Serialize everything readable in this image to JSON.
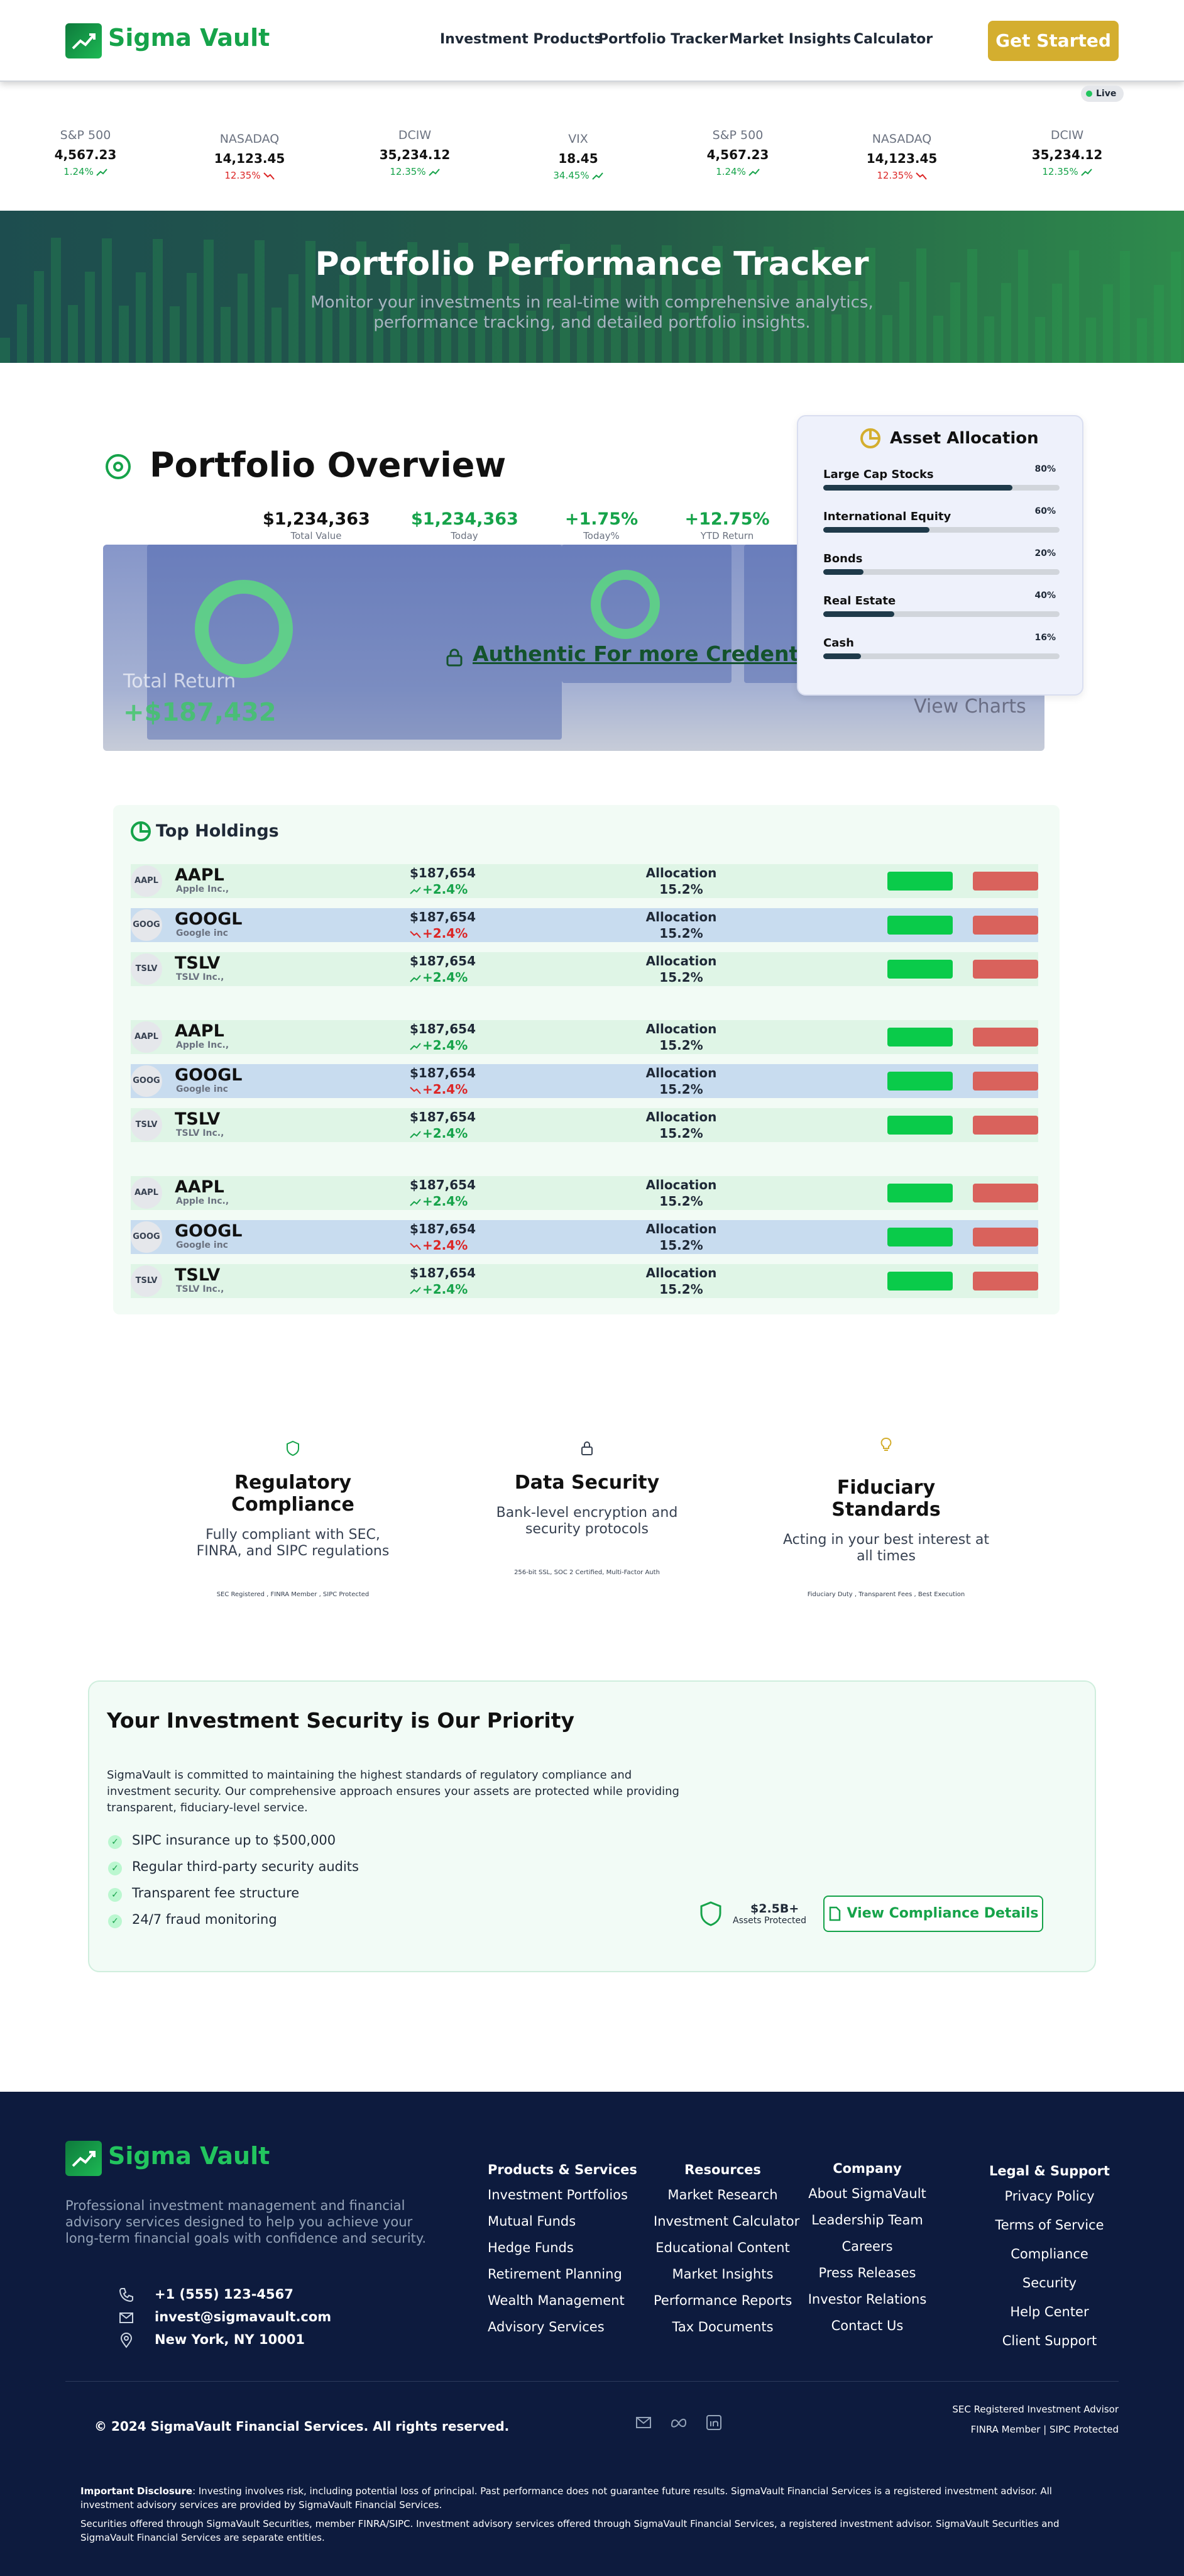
{
  "brand": "Sigma Vault",
  "nav": {
    "links": [
      "Investment Products",
      "Portfolio Tracker",
      "Market Insights",
      "Calculator"
    ],
    "cta": "Get Started"
  },
  "ticker": {
    "live": "Live",
    "items": [
      {
        "sym": "S&P 500",
        "val": "4,567.23",
        "chg": "1.24%",
        "dir": "up"
      },
      {
        "sym": "NASADAQ",
        "val": "14,123.45",
        "chg": "12.35%",
        "dir": "down"
      },
      {
        "sym": "DCIW",
        "val": "35,234.12",
        "chg": "12.35%",
        "dir": "up"
      },
      {
        "sym": "VIX",
        "val": "18.45",
        "chg": "34.45%",
        "dir": "up"
      },
      {
        "sym": "S&P 500",
        "val": "4,567.23",
        "chg": "1.24%",
        "dir": "up"
      },
      {
        "sym": "NASADAQ",
        "val": "14,123.45",
        "chg": "12.35%",
        "dir": "down"
      },
      {
        "sym": "DCIW",
        "val": "35,234.12",
        "chg": "12.35%",
        "dir": "up"
      }
    ]
  },
  "hero": {
    "title": "Portfolio Performance Tracker",
    "subtitle": "Monitor your investments in real-time with comprehensive analytics, performance tracking, and detailed portfolio insights."
  },
  "overview": {
    "title": "Portfolio Overview",
    "stats": [
      {
        "value": "$1,234,363",
        "label": "Total Value",
        "color": "#111111"
      },
      {
        "value": "$1,234,363",
        "label": "Today",
        "color": "#16a34a"
      },
      {
        "value": "+1.75%",
        "label": "Today%",
        "color": "#16a34a"
      },
      {
        "value": "+12.75%",
        "label": "YTD Return",
        "color": "#16a34a"
      }
    ],
    "locked_total_label": "Total Return",
    "locked_total_value": "+$187,432",
    "locked_view": "View Charts",
    "auth_link": "Authentic For more Credentials"
  },
  "allocation": {
    "title": "Asset Allocation",
    "items": [
      {
        "name": "Large Cap Stocks",
        "pct": "80%",
        "fill": 0.8
      },
      {
        "name": "International Equity",
        "pct": "60%",
        "fill": 0.45
      },
      {
        "name": "Bonds",
        "pct": "20%",
        "fill": 0.17
      },
      {
        "name": "Real Estate",
        "pct": "40%",
        "fill": 0.3
      },
      {
        "name": "Cash",
        "pct": "16%",
        "fill": 0.16
      }
    ]
  },
  "holdings": {
    "title": "Top Holdings",
    "alloc_label": "Allocation",
    "rows": [
      {
        "badge": "AAPL",
        "ticker": "AAPL",
        "company": "Apple Inc.,",
        "price": "$187,654",
        "change": "+2.4%",
        "dir": "up",
        "alloc": "15.2%",
        "tone": "green"
      },
      {
        "badge": "GOOG",
        "ticker": "GOOGL",
        "company": "Google inc",
        "price": "$187,654",
        "change": "+2.4%",
        "dir": "down",
        "alloc": "15.2%",
        "tone": "blue"
      },
      {
        "badge": "TSLV",
        "ticker": "TSLV",
        "company": "TSLV Inc.,",
        "price": "$187,654",
        "change": "+2.4%",
        "dir": "up",
        "alloc": "15.2%",
        "tone": "green"
      },
      {
        "badge": "AAPL",
        "ticker": "AAPL",
        "company": "Apple Inc.,",
        "price": "$187,654",
        "change": "+2.4%",
        "dir": "up",
        "alloc": "15.2%",
        "tone": "green"
      },
      {
        "badge": "GOOG",
        "ticker": "GOOGL",
        "company": "Google inc",
        "price": "$187,654",
        "change": "+2.4%",
        "dir": "down",
        "alloc": "15.2%",
        "tone": "blue"
      },
      {
        "badge": "TSLV",
        "ticker": "TSLV",
        "company": "TSLV Inc.,",
        "price": "$187,654",
        "change": "+2.4%",
        "dir": "up",
        "alloc": "15.2%",
        "tone": "green"
      },
      {
        "badge": "AAPL",
        "ticker": "AAPL",
        "company": "Apple Inc.,",
        "price": "$187,654",
        "change": "+2.4%",
        "dir": "up",
        "alloc": "15.2%",
        "tone": "green"
      },
      {
        "badge": "GOOG",
        "ticker": "GOOGL",
        "company": "Google inc",
        "price": "$187,654",
        "change": "+2.4%",
        "dir": "down",
        "alloc": "15.2%",
        "tone": "blue"
      },
      {
        "badge": "TSLV",
        "ticker": "TSLV",
        "company": "TSLV Inc.,",
        "price": "$187,654",
        "change": "+2.4%",
        "dir": "up",
        "alloc": "15.2%",
        "tone": "green"
      }
    ]
  },
  "features": [
    {
      "title": "Regulatory Compliance",
      "desc": "Fully compliant with SEC, FINRA, and SIPC regulations",
      "small": "SEC Registered , FINRA Member , SIPC Protected",
      "icon": "shield-icon"
    },
    {
      "title": "Data Security",
      "desc": "Bank-level encryption and security protocols",
      "small": "256-bit SSL, SOC 2 Certified, Multi-Factor Auth",
      "icon": "lock-icon"
    },
    {
      "title": "Fiduciary Standards",
      "desc": "Acting in your best interest at all times",
      "small": "Fiduciary Duty , Transparent Fees , Best Execution",
      "icon": "lightbulb-icon"
    }
  ],
  "security": {
    "title": "Your Investment Security is Our Priority",
    "body": "SigmaVault is committed to maintaining the highest standards of regulatory compliance and investment security. Our comprehensive approach ensures your assets are protected while providing transparent, fiduciary-level service.",
    "checks": [
      "SIPC insurance up to $500,000",
      "Regular third-party security audits",
      "Transparent fee structure",
      "24/7 fraud monitoring"
    ],
    "assets_value": "$2.5B+",
    "assets_label": "Assets Protected",
    "button": "View Compliance Details"
  },
  "footer": {
    "desc": "Professional investment management and financial advisory services designed to help you achieve your long-term financial goals with confidence and security.",
    "phone": "+1 (555) 123-4567",
    "email": "invest@sigmavault.com",
    "address": "New York, NY 10001",
    "products": {
      "heading": "Products & Services",
      "items": [
        "Investment Portfolios",
        "Mutual Funds",
        "Hedge Funds",
        "Retirement Planning",
        "Wealth Management",
        "Advisory Services"
      ]
    },
    "resources": {
      "heading": "Resources",
      "items": [
        "Market Research",
        "Investment Calculator",
        "Educational Content",
        "Market Insights",
        "Performance Reports",
        "Tax Documents"
      ]
    },
    "company": {
      "heading": "Company",
      "items": [
        "About SigmaVault",
        "Leadership Team",
        "Careers",
        "Press Releases",
        "Investor Relations",
        "Contact Us"
      ]
    },
    "legal": {
      "heading": "Legal & Support",
      "items": [
        "Privacy Policy",
        "Terms of Service",
        "Compliance",
        "Security",
        "Help Center",
        "Client Support"
      ]
    },
    "copyright": "2024 SigmaVault Financial Services. All rights reserved.",
    "reg1": "SEC Registered Investment Advisor",
    "reg2": "FINRA Member | SIPC Protected",
    "disclosure_label": "Important Disclosure",
    "disclosure": ": Investing involves risk, including potential loss of principal. Past performance does not guarantee future results. SigmaVault Financial Services is a registered investment advisor. All investment advisory services are provided by SigmaVault Financial Services.",
    "disclosure2": "Securities offered through SigmaVault Securities, member FINRA/SIPC. Investment advisory services offered through SigmaVault Financial Services, a registered investment advisor. SigmaVault Securities and SigmaVault Financial Services are separate entities."
  }
}
